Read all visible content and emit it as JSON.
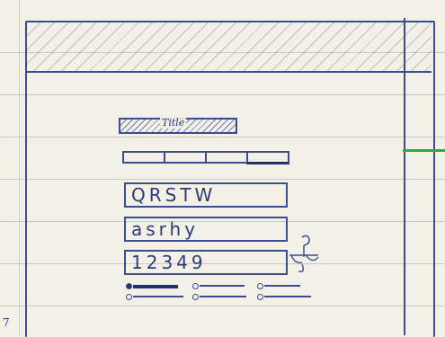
{
  "page": {
    "title": "Title"
  },
  "tabs": [
    {
      "label": ""
    },
    {
      "label": ""
    },
    {
      "label": ""
    },
    {
      "label": "",
      "active": true
    }
  ],
  "fields": {
    "field1_value": "QRSTW",
    "field2_value": "asrhy",
    "field3_value": "12349"
  },
  "slider_groups": [
    {
      "level": 0.75
    },
    {
      "level": 0.15
    },
    {
      "level": 0.15
    }
  ],
  "icons": {
    "doodle": "scales-doodle-icon"
  },
  "colors": {
    "ink": "#3a4d8c",
    "accent": "#2ea84a"
  }
}
